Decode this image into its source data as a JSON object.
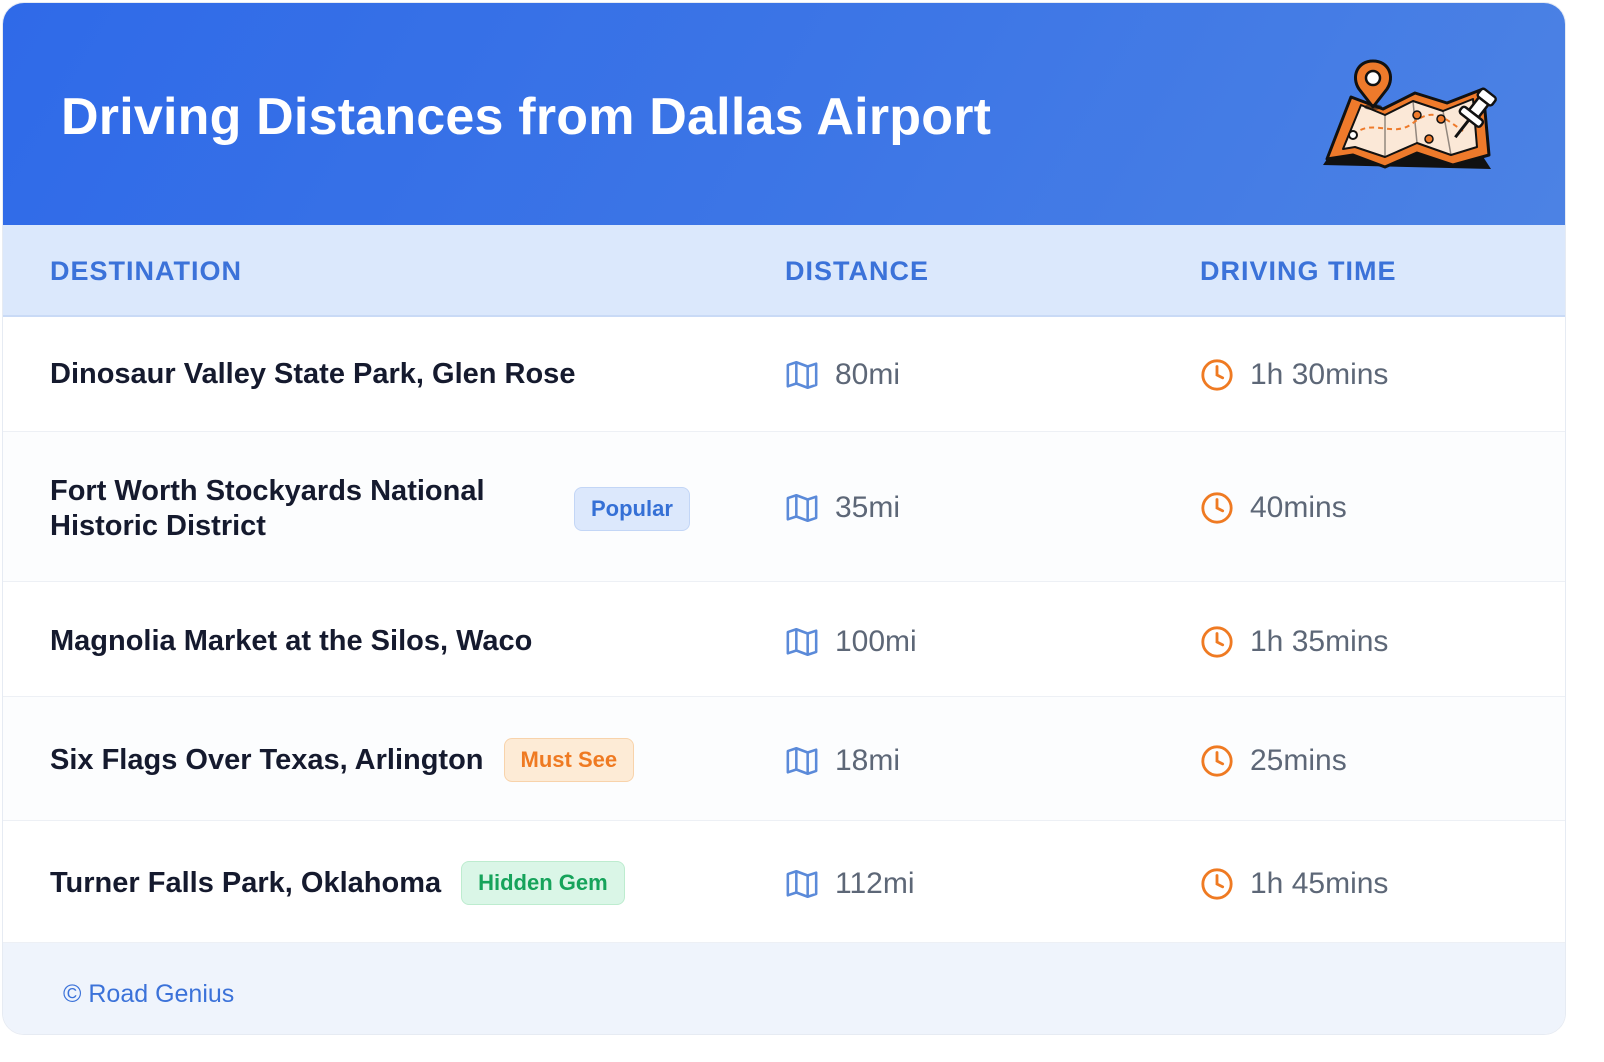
{
  "header": {
    "title": "Driving Distances from Dallas Airport"
  },
  "table": {
    "columns": [
      "DESTINATION",
      "DISTANCE",
      "DRIVING TIME"
    ],
    "rows": [
      {
        "destination": "Dinosaur Valley State Park, Glen Rose",
        "badge": "",
        "distance": "80mi",
        "time": "1h 30mins"
      },
      {
        "destination": "Fort Worth Stockyards National Historic District",
        "badge": "Popular",
        "distance": "35mi",
        "time": "40mins"
      },
      {
        "destination": "Magnolia Market at the Silos, Waco",
        "badge": "",
        "distance": "100mi",
        "time": "1h 35mins"
      },
      {
        "destination": "Six Flags Over Texas, Arlington",
        "badge": "Must See",
        "distance": "18mi",
        "time": "25mins"
      },
      {
        "destination": "Turner Falls Park, Oklahoma",
        "badge": "Hidden Gem",
        "distance": "112mi",
        "time": "1h 45mins"
      }
    ]
  },
  "footer": {
    "copyright": "© Road Genius"
  },
  "icons": {
    "distance": "map-icon",
    "time": "clock-icon",
    "header": "map-pin-illustration"
  },
  "colors": {
    "header_blue": "#2f6ae8",
    "accent_blue": "#3b72d9",
    "orange": "#ef7a22",
    "green": "#16a35b"
  }
}
